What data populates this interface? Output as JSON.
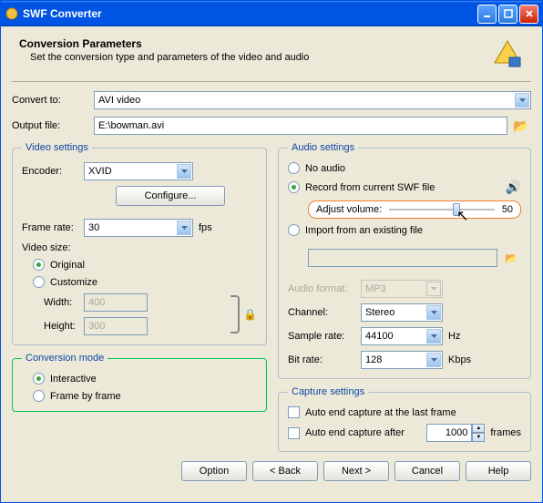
{
  "titlebar": {
    "title": "SWF Converter"
  },
  "header": {
    "title": "Conversion Parameters",
    "sub": "Set the conversion type and parameters of the video and audio"
  },
  "convert": {
    "label": "Convert to:",
    "value": "AVI video"
  },
  "output": {
    "label": "Output file:",
    "value": "E:\\bowman.avi"
  },
  "video": {
    "legend": "Video settings",
    "encoder_label": "Encoder:",
    "encoder_value": "XVID",
    "configure": "Configure...",
    "framerate_label": "Frame rate:",
    "framerate_value": "30",
    "fps": "fps",
    "size_label": "Video size:",
    "original": "Original",
    "customize": "Customize",
    "width_label": "Width:",
    "width_value": "400",
    "height_label": "Height:",
    "height_value": "300"
  },
  "conv_mode": {
    "legend": "Conversion mode",
    "interactive": "Interactive",
    "framebyframe": "Frame by frame"
  },
  "audio": {
    "legend": "Audio settings",
    "no_audio": "No audio",
    "record": "Record from current SWF file",
    "adjust_label": "Adjust volume:",
    "adjust_value": "50",
    "import": "Import from an existing file",
    "format_label": "Audio format:",
    "format_value": "MP3",
    "channel_label": "Channel:",
    "channel_value": "Stereo",
    "sample_label": "Sample rate:",
    "sample_value": "44100",
    "sample_unit": "Hz",
    "bitrate_label": "Bit rate:",
    "bitrate_value": "128",
    "bitrate_unit": "Kbps"
  },
  "capture": {
    "legend": "Capture settings",
    "autoend_last": "Auto end capture at the last frame",
    "autoend_after": "Auto end capture after",
    "frames_value": "1000",
    "frames_unit": "frames"
  },
  "buttons": {
    "option": "Option",
    "back": "< Back",
    "next": "Next >",
    "cancel": "Cancel",
    "help": "Help"
  }
}
